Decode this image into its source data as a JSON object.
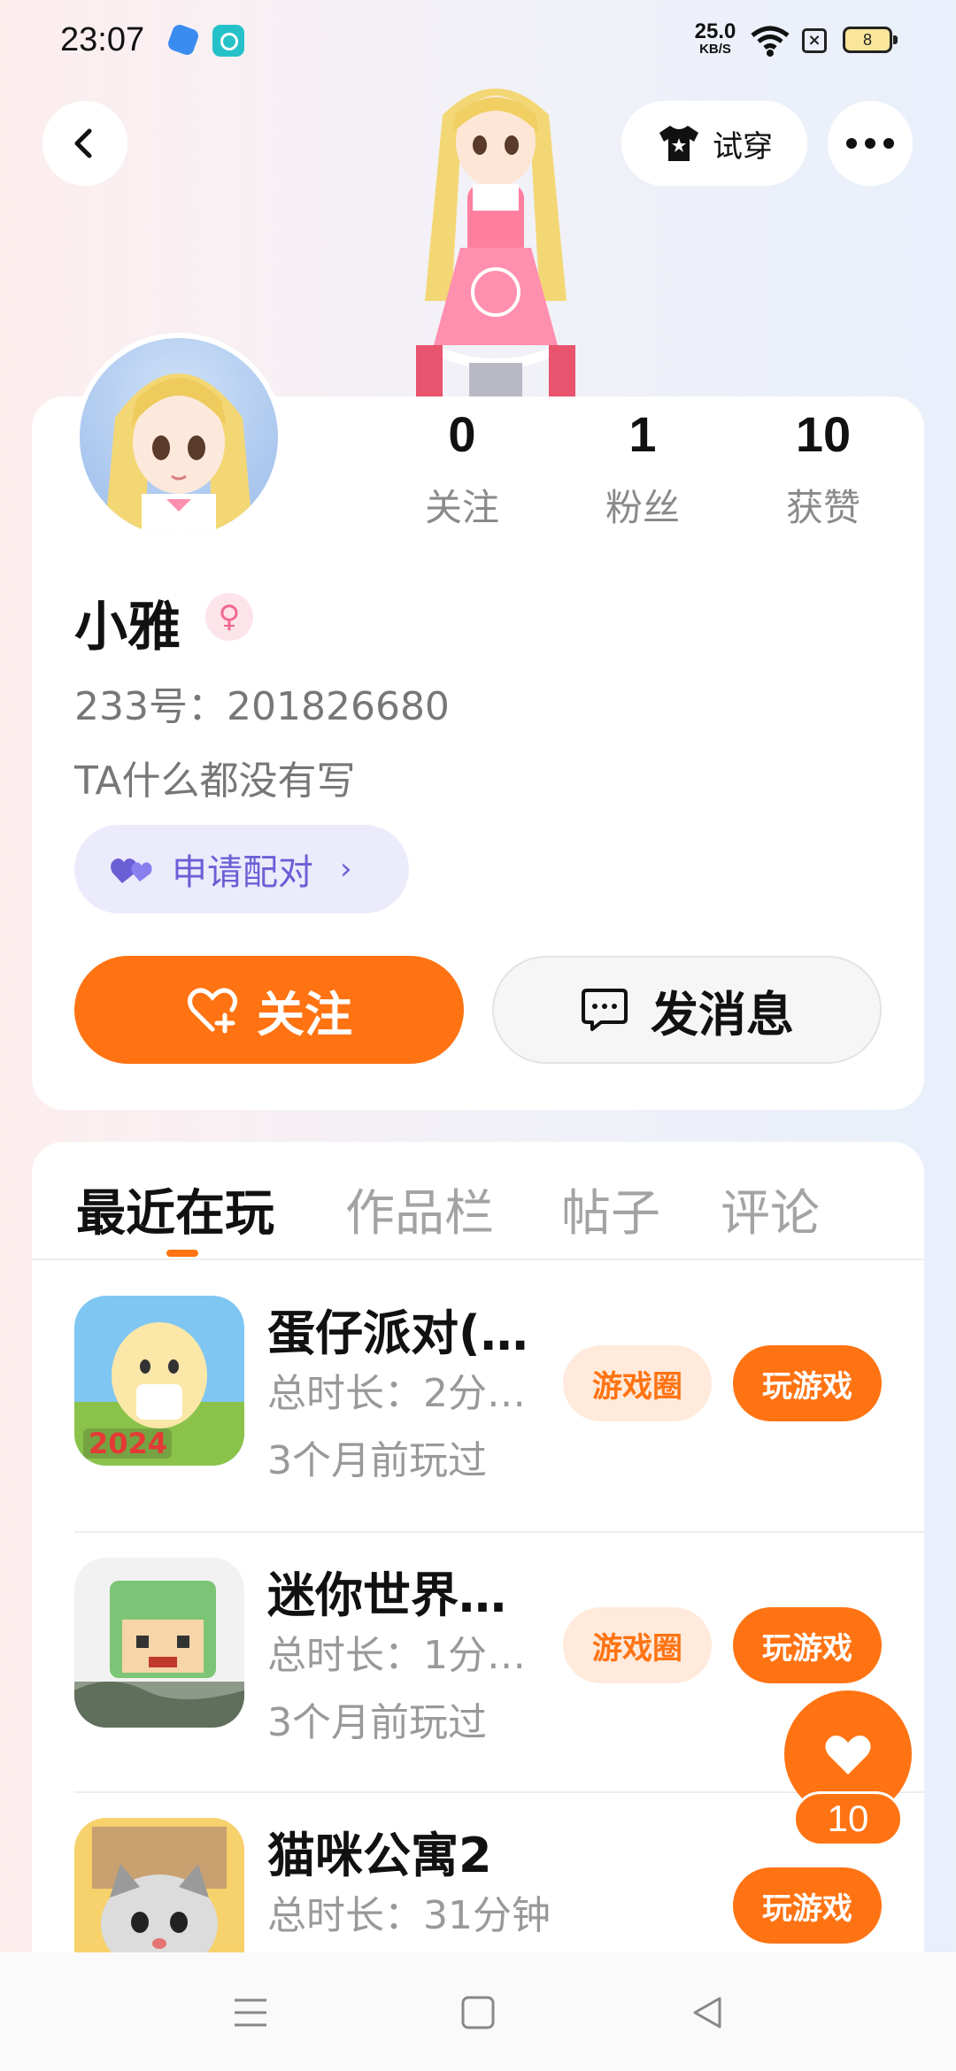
{
  "status_bar": {
    "time": "23:07",
    "net_speed_value": "25.0",
    "net_speed_unit": "KB/S",
    "battery": "8"
  },
  "header": {
    "try_on_label": "试穿"
  },
  "profile": {
    "name": "小雅",
    "gender_symbol": "♀",
    "uid": "233号：201826680",
    "bio": "TA什么都没有写",
    "pair_label": "申请配对",
    "pair_chevron": "›",
    "stats": [
      {
        "value": "0",
        "label": "关注"
      },
      {
        "value": "1",
        "label": "粉丝"
      },
      {
        "value": "10",
        "label": "获赞"
      }
    ],
    "follow_label": "关注",
    "message_label": "发消息"
  },
  "tabs": [
    "最近在玩",
    "作品栏",
    "帖子",
    "评论"
  ],
  "games": [
    {
      "title": "蛋仔派对(…",
      "duration": "总时长：2分…",
      "last_played": "3个月前玩过",
      "circle_label": "游戏圈",
      "play_label": "玩游戏",
      "icon_text": "2024"
    },
    {
      "title": "迷你世界…",
      "duration": "总时长：1分…",
      "last_played": "3个月前玩过",
      "circle_label": "游戏圈",
      "play_label": "玩游戏"
    },
    {
      "title": "猫咪公寓2",
      "duration": "总时长：31分钟",
      "play_label": "玩游戏"
    }
  ],
  "like_fab": {
    "count": "10"
  },
  "colors": {
    "accent": "#ff7313",
    "pair": "#6b5fd6",
    "muted": "#999999"
  }
}
